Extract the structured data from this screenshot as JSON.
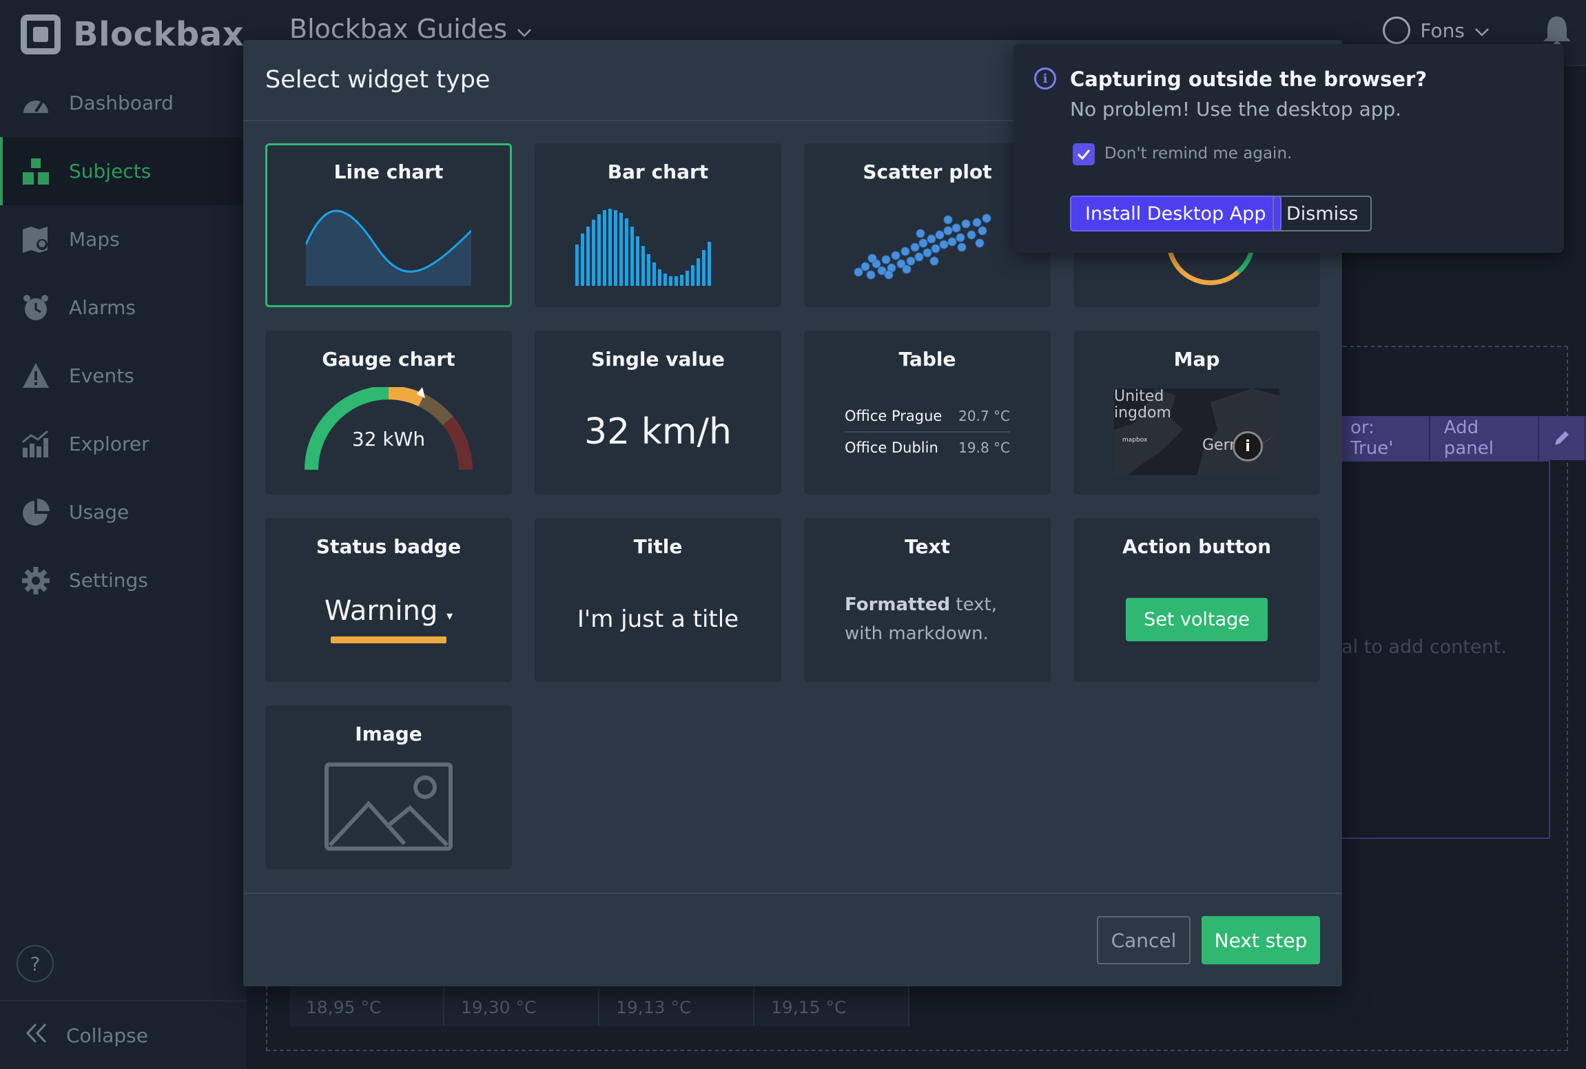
{
  "app": {
    "logo_text": "Blockbax"
  },
  "sidebar": {
    "items": [
      {
        "label": "Dashboard",
        "icon": "speedometer-icon"
      },
      {
        "label": "Subjects",
        "icon": "cubes-icon",
        "active": true
      },
      {
        "label": "Maps",
        "icon": "map-pin-icon"
      },
      {
        "label": "Alarms",
        "icon": "alarm-clock-icon"
      },
      {
        "label": "Events",
        "icon": "warning-triangle-icon"
      },
      {
        "label": "Explorer",
        "icon": "bar-chart-icon"
      },
      {
        "label": "Usage",
        "icon": "pie-chart-icon"
      },
      {
        "label": "Settings",
        "icon": "gear-icon"
      }
    ],
    "help_label": "?",
    "collapse_label": "Collapse"
  },
  "topbar": {
    "workspace": "Blockbax Guides",
    "user": "Fons"
  },
  "background": {
    "panel_condition": "or: True'",
    "add_panel": "Add panel",
    "empty_hint": "nal to add content.",
    "stats": [
      "18,95 °C",
      "19,30 °C",
      "19,13 °C",
      "19,15 °C"
    ]
  },
  "modal": {
    "title": "Select widget type",
    "widgets": {
      "line_chart": "Line chart",
      "bar_chart": "Bar chart",
      "scatter_plot": "Scatter plot",
      "gauge_chart": "Gauge chart",
      "gauge_value": "32 kWh",
      "single_value": "Single value",
      "single_value_sample": "32 km/h",
      "table": "Table",
      "table_rows": [
        {
          "name": "Office Prague",
          "value": "20.7 °C"
        },
        {
          "name": "Office Dublin",
          "value": "19.8 °C"
        }
      ],
      "map": "Map",
      "map_label_1": "United\ningdom",
      "map_label_2": "Gern",
      "map_brand": "mapbox",
      "status_badge": "Status badge",
      "status_badge_sample": "Warning",
      "title": "Title",
      "title_sample": "I'm just a title",
      "text": "Text",
      "text_bold": "Formatted",
      "text_rest": " text, with markdown.",
      "action_button": "Action button",
      "action_button_sample": "Set voltage",
      "image": "Image"
    },
    "cancel": "Cancel",
    "next": "Next step"
  },
  "popup": {
    "title": "Capturing outside the browser?",
    "subtitle": "No problem! Use the desktop app.",
    "checkbox_label": "Don't remind me again.",
    "checkbox_checked": true,
    "install": "Install Desktop App",
    "dismiss": "Dismiss"
  },
  "colors": {
    "accent_green": "#2eb872",
    "accent_purple": "#4c3ff0",
    "chart_blue": "#1aa3e8",
    "warning_orange": "#f0a840"
  }
}
